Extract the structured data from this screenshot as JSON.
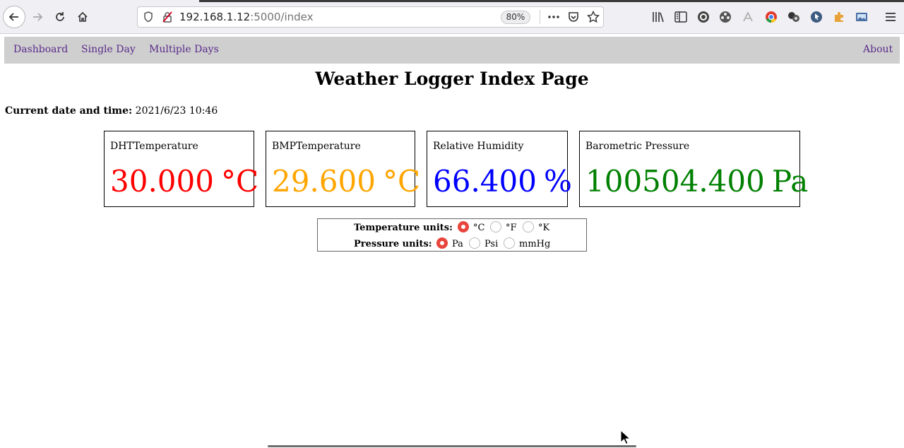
{
  "browser": {
    "url_host": "192.168.1.12",
    "url_rest": ":5000/index",
    "zoom": "80%",
    "icons": [
      "back-icon",
      "forward-icon",
      "reload-icon",
      "home-icon",
      "shield-icon",
      "insecure-lock-icon",
      "more-icon",
      "pocket-icon",
      "bookmark-star-icon",
      "library-icon",
      "sidebar-icon",
      "extension-icons",
      "menu-icon"
    ]
  },
  "nav": {
    "dashboard": "Dashboard",
    "single_day": "Single Day",
    "multiple_days": "Multiple Days",
    "about": "About"
  },
  "page": {
    "title": "Weather Logger Index Page",
    "datetime_label": "Current date and time:",
    "datetime_value": "2021/6/23 10:46"
  },
  "cards": {
    "dht": {
      "label": "DHTTemperature",
      "value": "30.000",
      "unit": "°C",
      "color": "#ff0000"
    },
    "bmp": {
      "label": "BMPTemperature",
      "value": "29.600",
      "unit": "°C",
      "color": "#ffa500"
    },
    "humidity": {
      "label": "Relative Humidity",
      "value": "66.400",
      "unit": "%",
      "color": "#0000ff"
    },
    "pressure": {
      "label": "Barometric Pressure",
      "value": "100504.400",
      "unit": "Pa",
      "color": "#008000"
    }
  },
  "units": {
    "temp_label": "Temperature units:",
    "temp_options": [
      "°C",
      "°F",
      "°K"
    ],
    "temp_selected": "°C",
    "pressure_label": "Pressure units:",
    "pressure_options": [
      "Pa",
      "Psi",
      "mmHg"
    ],
    "pressure_selected": "Pa"
  }
}
